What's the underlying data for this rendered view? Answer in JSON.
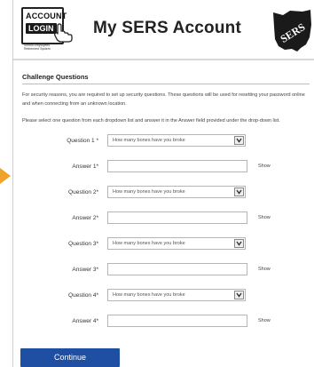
{
  "logo": {
    "line1": "ACCOUNT",
    "line2": "LOGIN",
    "small_text": "School Employees Retirement System"
  },
  "header": {
    "title": "My SERS Account"
  },
  "state_logo": {
    "text": "SERS"
  },
  "section": {
    "title": "Challenge Questions",
    "intro": "For security reasons, you are required to set up security questions. These questions will be used for resetting your password online and when connecting from an unknown location.",
    "instructions": "Please select one question from each dropdown list and answer it in the Answer field provided under the drop-down list."
  },
  "form": {
    "rows": [
      {
        "kind": "question",
        "label": "Question 1 *",
        "value": "How many bones have you broke"
      },
      {
        "kind": "answer",
        "label": "Answer 1*",
        "show": "Show"
      },
      {
        "kind": "question",
        "label": "Question 2*",
        "value": "How many bones have you broke"
      },
      {
        "kind": "answer",
        "label": "Answer 2*",
        "show": "Show"
      },
      {
        "kind": "question",
        "label": "Question 3*",
        "value": "How many bones have you broke"
      },
      {
        "kind": "answer",
        "label": "Answer 3*",
        "show": "Show"
      },
      {
        "kind": "question",
        "label": "Question 4*",
        "value": "How many bones have you broke"
      },
      {
        "kind": "answer",
        "label": "Answer 4*",
        "show": "Show"
      }
    ]
  },
  "continue_label": "Continue",
  "colors": {
    "accent_arrow": "#f0a32a",
    "button": "#1f4fa3"
  }
}
